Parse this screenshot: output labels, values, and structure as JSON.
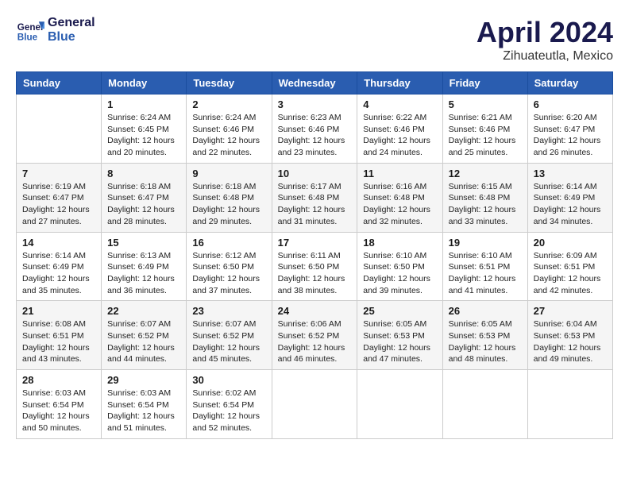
{
  "header": {
    "logo_line1": "General",
    "logo_line2": "Blue",
    "month": "April 2024",
    "location": "Zihuateutla, Mexico"
  },
  "weekdays": [
    "Sunday",
    "Monday",
    "Tuesday",
    "Wednesday",
    "Thursday",
    "Friday",
    "Saturday"
  ],
  "days": [
    {
      "num": "",
      "sunrise": "",
      "sunset": "",
      "daylight": ""
    },
    {
      "num": "1",
      "sunrise": "Sunrise: 6:24 AM",
      "sunset": "Sunset: 6:45 PM",
      "daylight": "Daylight: 12 hours and 20 minutes."
    },
    {
      "num": "2",
      "sunrise": "Sunrise: 6:24 AM",
      "sunset": "Sunset: 6:46 PM",
      "daylight": "Daylight: 12 hours and 22 minutes."
    },
    {
      "num": "3",
      "sunrise": "Sunrise: 6:23 AM",
      "sunset": "Sunset: 6:46 PM",
      "daylight": "Daylight: 12 hours and 23 minutes."
    },
    {
      "num": "4",
      "sunrise": "Sunrise: 6:22 AM",
      "sunset": "Sunset: 6:46 PM",
      "daylight": "Daylight: 12 hours and 24 minutes."
    },
    {
      "num": "5",
      "sunrise": "Sunrise: 6:21 AM",
      "sunset": "Sunset: 6:46 PM",
      "daylight": "Daylight: 12 hours and 25 minutes."
    },
    {
      "num": "6",
      "sunrise": "Sunrise: 6:20 AM",
      "sunset": "Sunset: 6:47 PM",
      "daylight": "Daylight: 12 hours and 26 minutes."
    },
    {
      "num": "7",
      "sunrise": "Sunrise: 6:19 AM",
      "sunset": "Sunset: 6:47 PM",
      "daylight": "Daylight: 12 hours and 27 minutes."
    },
    {
      "num": "8",
      "sunrise": "Sunrise: 6:18 AM",
      "sunset": "Sunset: 6:47 PM",
      "daylight": "Daylight: 12 hours and 28 minutes."
    },
    {
      "num": "9",
      "sunrise": "Sunrise: 6:18 AM",
      "sunset": "Sunset: 6:48 PM",
      "daylight": "Daylight: 12 hours and 29 minutes."
    },
    {
      "num": "10",
      "sunrise": "Sunrise: 6:17 AM",
      "sunset": "Sunset: 6:48 PM",
      "daylight": "Daylight: 12 hours and 31 minutes."
    },
    {
      "num": "11",
      "sunrise": "Sunrise: 6:16 AM",
      "sunset": "Sunset: 6:48 PM",
      "daylight": "Daylight: 12 hours and 32 minutes."
    },
    {
      "num": "12",
      "sunrise": "Sunrise: 6:15 AM",
      "sunset": "Sunset: 6:48 PM",
      "daylight": "Daylight: 12 hours and 33 minutes."
    },
    {
      "num": "13",
      "sunrise": "Sunrise: 6:14 AM",
      "sunset": "Sunset: 6:49 PM",
      "daylight": "Daylight: 12 hours and 34 minutes."
    },
    {
      "num": "14",
      "sunrise": "Sunrise: 6:14 AM",
      "sunset": "Sunset: 6:49 PM",
      "daylight": "Daylight: 12 hours and 35 minutes."
    },
    {
      "num": "15",
      "sunrise": "Sunrise: 6:13 AM",
      "sunset": "Sunset: 6:49 PM",
      "daylight": "Daylight: 12 hours and 36 minutes."
    },
    {
      "num": "16",
      "sunrise": "Sunrise: 6:12 AM",
      "sunset": "Sunset: 6:50 PM",
      "daylight": "Daylight: 12 hours and 37 minutes."
    },
    {
      "num": "17",
      "sunrise": "Sunrise: 6:11 AM",
      "sunset": "Sunset: 6:50 PM",
      "daylight": "Daylight: 12 hours and 38 minutes."
    },
    {
      "num": "18",
      "sunrise": "Sunrise: 6:10 AM",
      "sunset": "Sunset: 6:50 PM",
      "daylight": "Daylight: 12 hours and 39 minutes."
    },
    {
      "num": "19",
      "sunrise": "Sunrise: 6:10 AM",
      "sunset": "Sunset: 6:51 PM",
      "daylight": "Daylight: 12 hours and 41 minutes."
    },
    {
      "num": "20",
      "sunrise": "Sunrise: 6:09 AM",
      "sunset": "Sunset: 6:51 PM",
      "daylight": "Daylight: 12 hours and 42 minutes."
    },
    {
      "num": "21",
      "sunrise": "Sunrise: 6:08 AM",
      "sunset": "Sunset: 6:51 PM",
      "daylight": "Daylight: 12 hours and 43 minutes."
    },
    {
      "num": "22",
      "sunrise": "Sunrise: 6:07 AM",
      "sunset": "Sunset: 6:52 PM",
      "daylight": "Daylight: 12 hours and 44 minutes."
    },
    {
      "num": "23",
      "sunrise": "Sunrise: 6:07 AM",
      "sunset": "Sunset: 6:52 PM",
      "daylight": "Daylight: 12 hours and 45 minutes."
    },
    {
      "num": "24",
      "sunrise": "Sunrise: 6:06 AM",
      "sunset": "Sunset: 6:52 PM",
      "daylight": "Daylight: 12 hours and 46 minutes."
    },
    {
      "num": "25",
      "sunrise": "Sunrise: 6:05 AM",
      "sunset": "Sunset: 6:53 PM",
      "daylight": "Daylight: 12 hours and 47 minutes."
    },
    {
      "num": "26",
      "sunrise": "Sunrise: 6:05 AM",
      "sunset": "Sunset: 6:53 PM",
      "daylight": "Daylight: 12 hours and 48 minutes."
    },
    {
      "num": "27",
      "sunrise": "Sunrise: 6:04 AM",
      "sunset": "Sunset: 6:53 PM",
      "daylight": "Daylight: 12 hours and 49 minutes."
    },
    {
      "num": "28",
      "sunrise": "Sunrise: 6:03 AM",
      "sunset": "Sunset: 6:54 PM",
      "daylight": "Daylight: 12 hours and 50 minutes."
    },
    {
      "num": "29",
      "sunrise": "Sunrise: 6:03 AM",
      "sunset": "Sunset: 6:54 PM",
      "daylight": "Daylight: 12 hours and 51 minutes."
    },
    {
      "num": "30",
      "sunrise": "Sunrise: 6:02 AM",
      "sunset": "Sunset: 6:54 PM",
      "daylight": "Daylight: 12 hours and 52 minutes."
    },
    {
      "num": "",
      "sunrise": "",
      "sunset": "",
      "daylight": ""
    },
    {
      "num": "",
      "sunrise": "",
      "sunset": "",
      "daylight": ""
    },
    {
      "num": "",
      "sunrise": "",
      "sunset": "",
      "daylight": ""
    },
    {
      "num": "",
      "sunrise": "",
      "sunset": "",
      "daylight": ""
    }
  ]
}
